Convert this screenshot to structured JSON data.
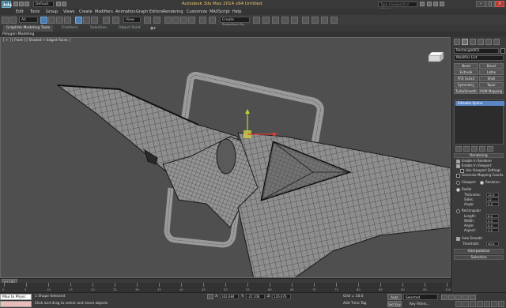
{
  "title_bar": {
    "app_icon": "3ds",
    "workspace": "Default",
    "window_title": "Autodesk 3ds Max 2014 x64     Untitled",
    "search_placeholder": "Type a keyword or phrase"
  },
  "menu": [
    "Edit",
    "Tools",
    "Group",
    "Views",
    "Create",
    "Modifiers",
    "Animation",
    "Graph Editors",
    "Rendering",
    "Customize",
    "MAXScript",
    "Help"
  ],
  "toolbar": {
    "selection_filter": "All",
    "reference_coord": "View",
    "named_selection": "Create Selection Se"
  },
  "ribbon": {
    "tabs": [
      "Graphite Modeling Tools",
      "Freeform",
      "Selection",
      "Object Paint"
    ],
    "sub_label": "Polygon Modeling"
  },
  "viewport": {
    "label": "[ + ] [ Front ] [ Shaded + Edged Faces ]"
  },
  "command_panel": {
    "object_name": "Rectangle001",
    "modifier_list": "Modifier List",
    "modifier_buttons": [
      "Bend",
      "Bevel",
      "Extrude",
      "Lathe",
      "FFD 3x3x3",
      "Shell",
      "Symmetry",
      "Taper",
      "TurboSmooth",
      "UVW Mapping Cle"
    ],
    "stack_item": "Editable Spline",
    "rendering": {
      "header": "Rendering",
      "enable_in_renderer": "Enable In Renderer",
      "enable_in_viewport": "Enable In Viewport",
      "use_viewport_settings": "Use Viewport Settings",
      "generate_mapping": "Generate Mapping Coords.",
      "viewport": "Viewport",
      "renderer": "Renderer",
      "radial": "Radial",
      "thickness_label": "Thickness:",
      "thickness_value": "12.0",
      "sides_label": "Sides:",
      "sides_value": "12",
      "angle_label": "Angle:",
      "angle_value": "0.0",
      "rectangular": "Rectangular",
      "length_label": "Length:",
      "length_value": "6.0",
      "width_label": "Width:",
      "width_value": "2.0",
      "angle2_label": "Angle:",
      "angle2_value": "0.0",
      "aspect_label": "Aspect:",
      "aspect_value": "3.0",
      "auto_smooth": "Auto Smooth",
      "threshold_label": "Threshold:",
      "threshold_value": "40.0"
    },
    "interpolation": "Interpolation",
    "selection": "Selection"
  },
  "timeline": {
    "frame": "0 / 100",
    "ticks": [
      "0",
      "5",
      "10",
      "15",
      "20",
      "25",
      "30",
      "35",
      "40",
      "45",
      "50",
      "55",
      "60",
      "65",
      "70",
      "75",
      "80",
      "85",
      "90",
      "95",
      "100"
    ]
  },
  "status": {
    "maxscript": "Max to Physc",
    "line1": "1 Shape Selected",
    "line2": "Click and drag to select and move objects",
    "x_label": "X:",
    "x_value": "102.684",
    "y_label": "Y:",
    "y_value": "-22.108",
    "z_label": "Z:",
    "z_value": "126.676",
    "grid": "Grid = 10.0",
    "add_time_tag": "Add Time Tag",
    "auto_key": "Auto Key",
    "set_key": "Set Key",
    "key_selected": "Selected",
    "key_filters": "Key Filters..."
  },
  "colors": {
    "viewport_bg": "#4f4f4f",
    "mesh_fill": "#8c8c8c",
    "mesh_line": "#1e1e1e",
    "stack_highlight": "#5a86c5",
    "gizmo_x": "#e33b2e",
    "gizmo_y": "#b7d62a"
  }
}
